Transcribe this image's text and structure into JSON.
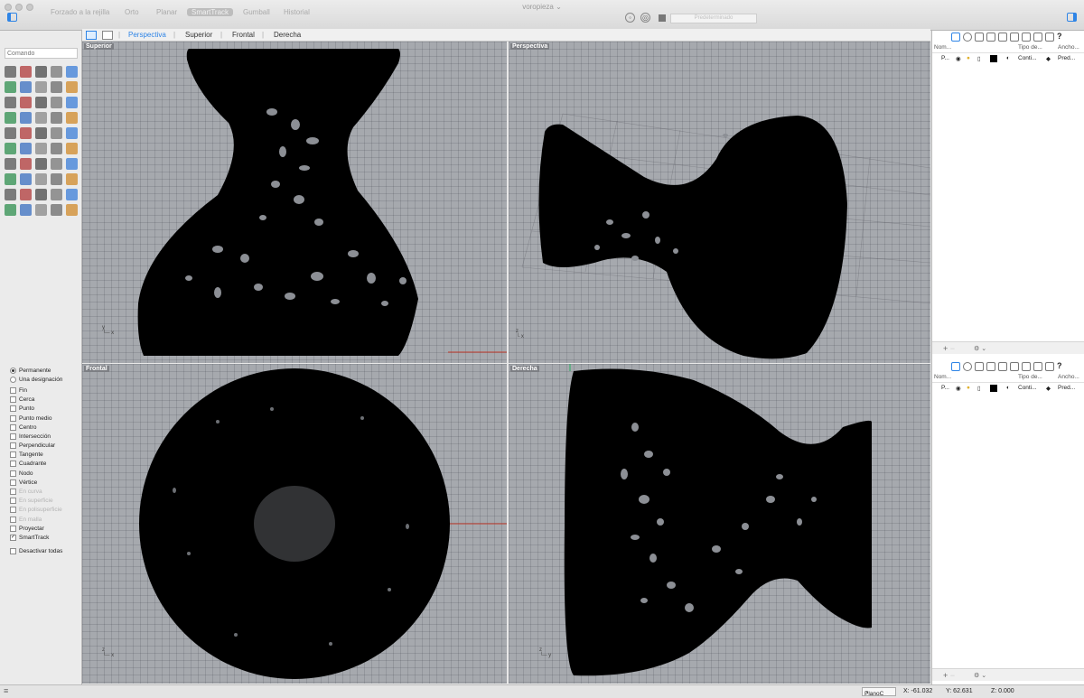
{
  "window": {
    "title": "voropieza ⌄"
  },
  "toolbar": {
    "toggles": [
      "Forzado a la rejilla",
      "Orto",
      "Planar",
      "SmartTrack",
      "Gumball",
      "Historial"
    ],
    "active_toggle": "SmartTrack",
    "layer_placeholder": "Predeterminado"
  },
  "viewport_tabs": [
    "Perspectiva",
    "Superior",
    "Frontal",
    "Derecha"
  ],
  "active_viewport_tab": "Perspectiva",
  "command": {
    "placeholder": "Comando"
  },
  "osnaps": {
    "mode": [
      {
        "label": "Permanente",
        "selected": true
      },
      {
        "label": "Una designación",
        "selected": false
      }
    ],
    "snaps": [
      {
        "label": "Fin",
        "checked": false,
        "enabled": true
      },
      {
        "label": "Cerca",
        "checked": false,
        "enabled": true
      },
      {
        "label": "Punto",
        "checked": false,
        "enabled": true
      },
      {
        "label": "Punto medio",
        "checked": false,
        "enabled": true
      },
      {
        "label": "Centro",
        "checked": false,
        "enabled": true
      },
      {
        "label": "Intersección",
        "checked": false,
        "enabled": true
      },
      {
        "label": "Perpendicular",
        "checked": false,
        "enabled": true
      },
      {
        "label": "Tangente",
        "checked": false,
        "enabled": true
      },
      {
        "label": "Cuadrante",
        "checked": false,
        "enabled": true
      },
      {
        "label": "Nodo",
        "checked": false,
        "enabled": true
      },
      {
        "label": "Vértice",
        "checked": false,
        "enabled": true
      },
      {
        "label": "En curva",
        "checked": false,
        "enabled": false
      },
      {
        "label": "En superficie",
        "checked": false,
        "enabled": false
      },
      {
        "label": "En polisuperficie",
        "checked": false,
        "enabled": false
      },
      {
        "label": "En malla",
        "checked": false,
        "enabled": false
      },
      {
        "label": "Proyectar",
        "checked": false,
        "enabled": true
      },
      {
        "label": "SmartTrack",
        "checked": true,
        "enabled": true
      }
    ],
    "disable_all": "Desactivar todas"
  },
  "viewports": {
    "top": {
      "label": "Superior"
    },
    "perspective": {
      "label": "Perspectiva"
    },
    "front": {
      "label": "Frontal"
    },
    "right": {
      "label": "Derecha"
    }
  },
  "layers_panel": {
    "columns": {
      "name": "Nom...",
      "linetype": "Tipo de...",
      "width": "Ancho..."
    },
    "row": {
      "name": "P...",
      "linetype": "Conti...",
      "width": "Pred..."
    }
  },
  "status": {
    "plane": "PlanoC",
    "x": "X: -61.032",
    "y": "Y: 62.631",
    "z": "Z: 0.000"
  },
  "colors": {
    "accent": "#2e84e6",
    "viewport_bg": "#a6a9ae",
    "mesh": "#000000"
  }
}
